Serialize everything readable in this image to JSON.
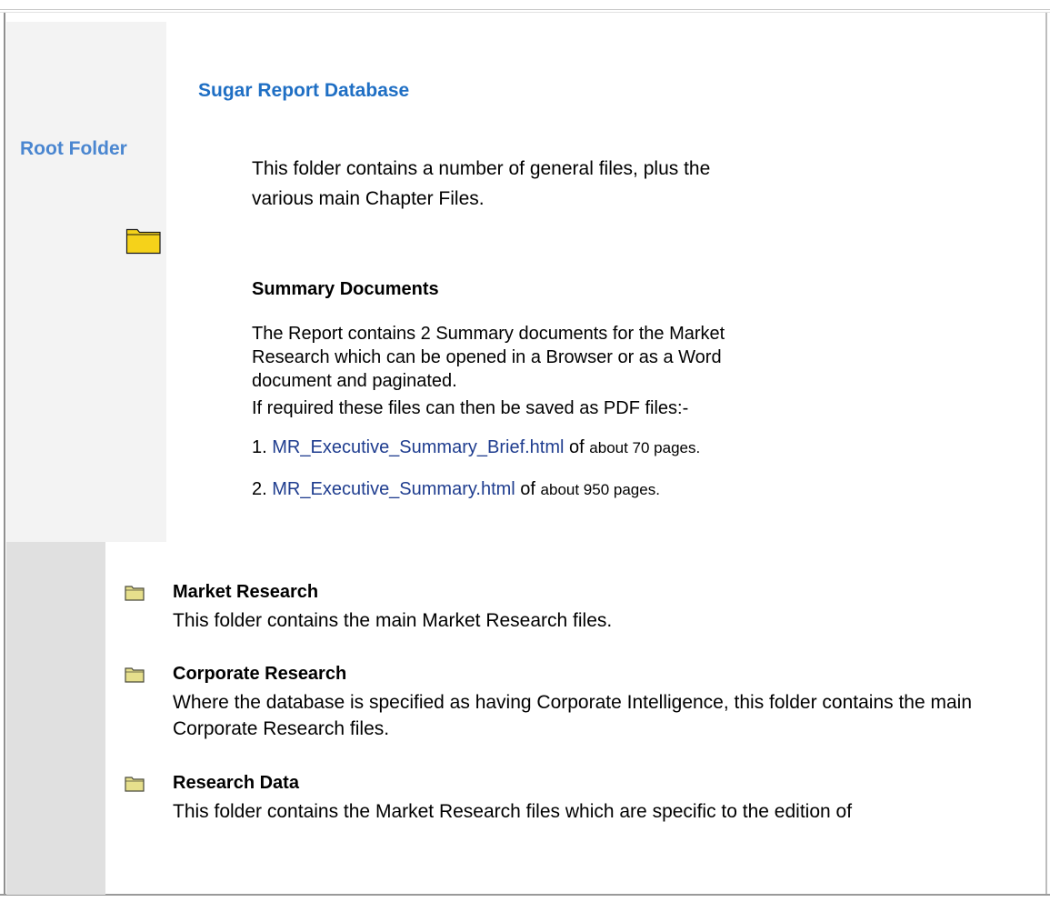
{
  "sidebar": {
    "root_label": "Root Folder"
  },
  "main": {
    "title": "Sugar Report Database",
    "intro": "This folder contains a number of general files, plus the various main Chapter Files.",
    "summary_heading": "Summary Documents",
    "summary_para1": "The Report contains 2 Summary documents for the Market Research which can be opened in a Browser or as a Word document and paginated.",
    "summary_para2": "If required these files can then be saved as PDF files:-",
    "files": [
      {
        "number": "1.",
        "link": "MR_Executive_Summary_Brief.html",
        "of": "of",
        "pages": "about 70 pages."
      },
      {
        "number": "2.",
        "link": "MR_Executive_Summary.html",
        "of": "of",
        "pages": "about 950 pages."
      }
    ]
  },
  "folders": [
    {
      "name": "Market Research",
      "description": "This folder contains the main Market Research files."
    },
    {
      "name": "Corporate Research",
      "description": "Where the database is specified as having Corporate Intelligence, this folder contains the main Corporate Research files."
    },
    {
      "name": "Research Data",
      "description": "This folder contains the Market Research files which are specific to the edition of"
    }
  ],
  "colors": {
    "link": "#1f3d8f",
    "title": "#1f6fc4",
    "sidebar_label": "#4a86d0",
    "folder_yellow": "#f5d21a"
  }
}
